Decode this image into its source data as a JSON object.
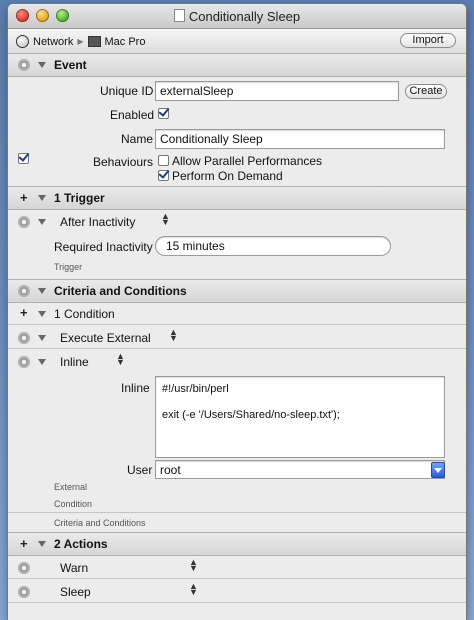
{
  "window": {
    "title": "Conditionally Sleep"
  },
  "pathbar": {
    "network": "Network",
    "host": "Mac Pro",
    "import_label": "Import"
  },
  "event": {
    "header": "Event",
    "unique_id_label": "Unique ID",
    "unique_id_value": "externalSleep",
    "create_label": "Create",
    "enabled_label": "Enabled",
    "name_label": "Name",
    "name_value": "Conditionally Sleep",
    "behaviours_label": "Behaviours",
    "allow_parallel_label": "Allow Parallel Performances",
    "perform_on_demand_label": "Perform On Demand"
  },
  "trigger": {
    "header": "1 Trigger",
    "type": "After Inactivity",
    "required_label": "Required Inactivity",
    "required_value": "15 minutes",
    "caption": "Trigger"
  },
  "criteria": {
    "header": "Criteria and Conditions",
    "condition_header": "1 Condition",
    "condition_type": "Execute External",
    "inline_type": "Inline",
    "inline_label": "Inline",
    "script_line1": "#!/usr/bin/perl",
    "script_line2": "exit (-e '/Users/Shared/no-sleep.txt');",
    "user_label": "User",
    "user_value": "root",
    "caption_external": "External",
    "caption_condition": "Condition",
    "caption_criteria": "Criteria and Conditions"
  },
  "actions": {
    "header": "2 Actions",
    "items": [
      "Warn",
      "Sleep"
    ]
  }
}
